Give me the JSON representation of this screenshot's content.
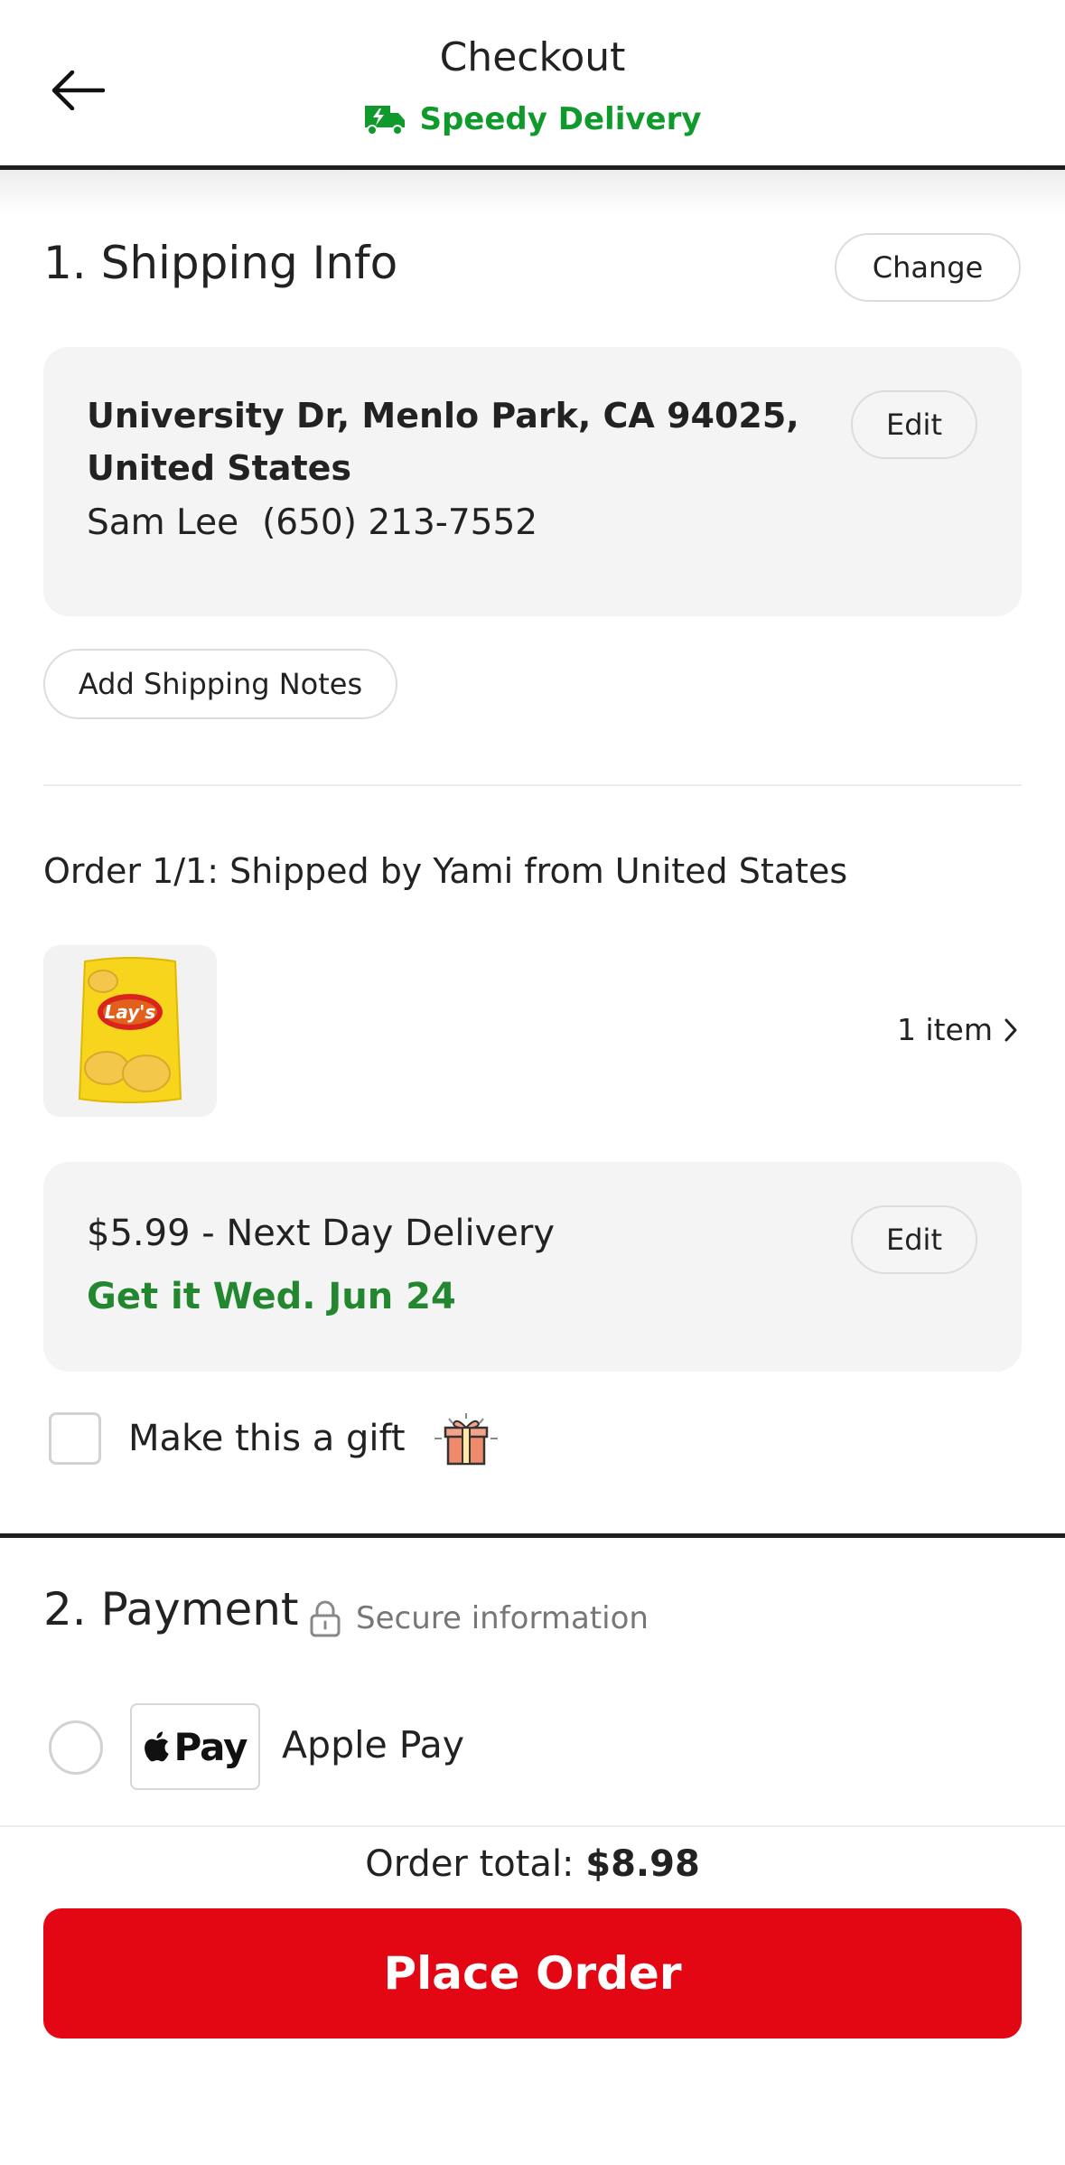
{
  "header": {
    "title": "Checkout",
    "subtitle": "Speedy Delivery",
    "accent_color": "#119a2c"
  },
  "shipping": {
    "heading": "1. Shipping Info",
    "change_label": "Change",
    "address_line1": "University Dr, Menlo Park, CA 94025,",
    "address_line2": "United States",
    "name": "Sam Lee",
    "phone": "(650) 213-7552",
    "edit_label": "Edit",
    "notes_label": "Add Shipping Notes"
  },
  "order": {
    "heading": "Order 1/1: Shipped by Yami from United States",
    "product_image": "lays-chips-bag",
    "item_count": "1 item",
    "delivery_option": "$5.99 - Next Day Delivery",
    "delivery_eta": "Get it Wed. Jun 24",
    "delivery_edit_label": "Edit",
    "eta_color": "#22872f",
    "gift_label": "Make this a gift"
  },
  "payment": {
    "heading": "2. Payment",
    "secure_label": "Secure information",
    "method_badge": "Pay",
    "method_label": "Apple Pay"
  },
  "footer": {
    "total_label": "Order total:",
    "total_value": "$8.98",
    "cta_label": "Place Order",
    "cta_color": "#e30613"
  }
}
